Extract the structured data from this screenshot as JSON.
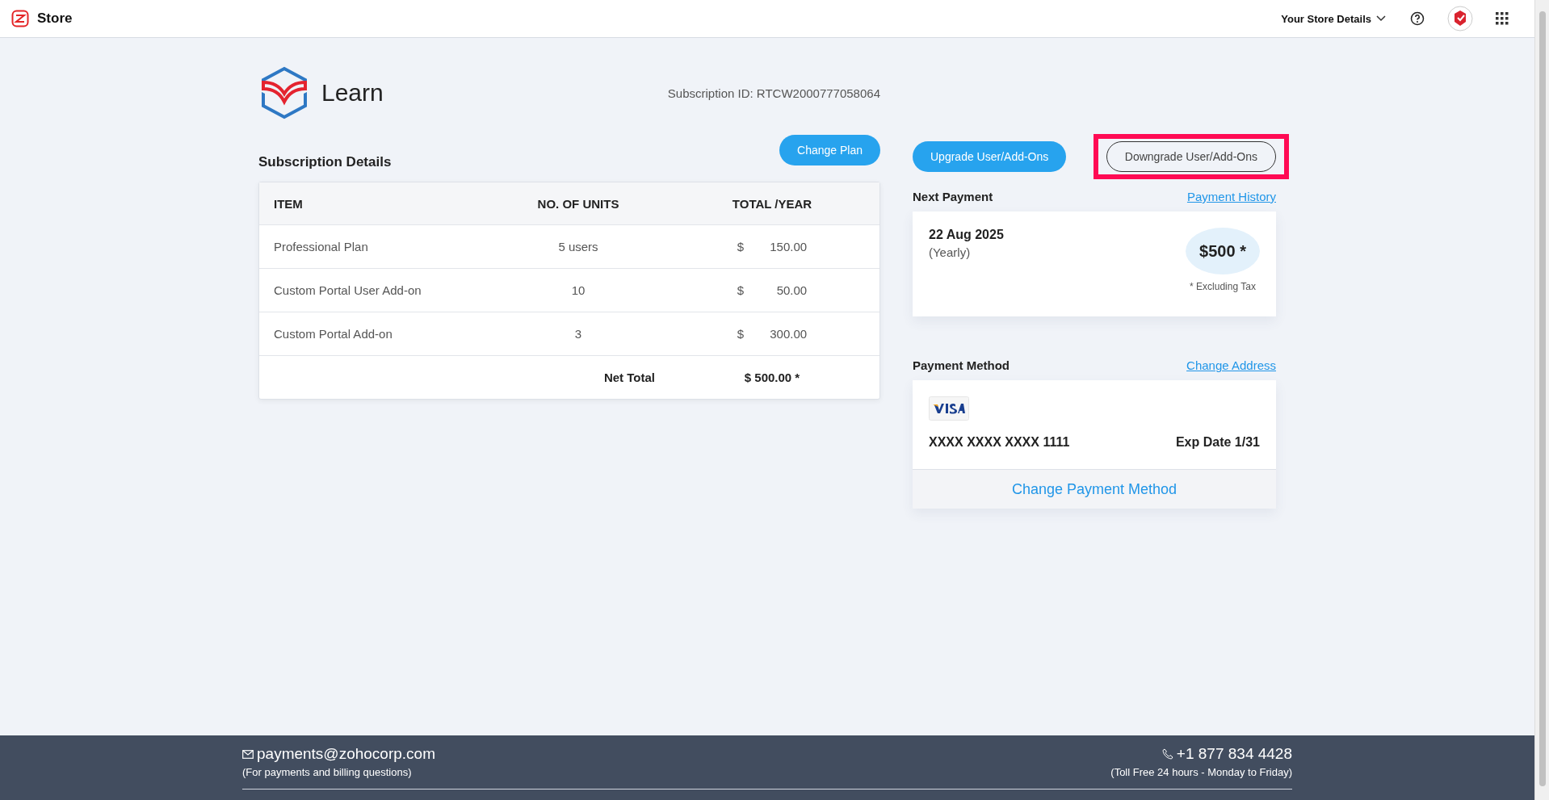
{
  "topbar": {
    "app_name": "Store",
    "store_menu": "Your Store Details"
  },
  "product": {
    "name": "Learn",
    "subscription_id": "Subscription ID: RTCW2000777058064"
  },
  "subscription": {
    "title": "Subscription Details",
    "change_plan": "Change Plan",
    "columns": [
      "ITEM",
      "NO. OF UNITS",
      "TOTAL /YEAR"
    ],
    "rows": [
      {
        "item": "Professional Plan",
        "units": "5 users",
        "currency": "$",
        "amount": "150.00"
      },
      {
        "item": "Custom Portal User Add-on",
        "units": "10",
        "currency": "$",
        "amount": "50.00"
      },
      {
        "item": "Custom Portal Add-on",
        "units": "3",
        "currency": "$",
        "amount": "300.00"
      }
    ],
    "net_total_label": "Net Total",
    "net_total": "$ 500.00 *"
  },
  "actions": [
    {
      "label": "Upgrade User/Add-Ons",
      "kind": "primary",
      "highlighted": false
    },
    {
      "label": "Downgrade User/Add-Ons",
      "kind": "outline",
      "highlighted": true
    }
  ],
  "next_payment": {
    "title": "Next Payment",
    "link": "Payment History",
    "date": "22 Aug 2025",
    "cycle": "(Yearly)",
    "amount": "$500 *",
    "note": "* Excluding Tax"
  },
  "payment_method": {
    "title": "Payment Method",
    "link": "Change Address",
    "card_number": "XXXX XXXX XXXX 1111",
    "expiry": "Exp Date 1/31",
    "change": "Change Payment Method"
  },
  "footer": {
    "email": "payments@zohocorp.com",
    "email_note": "(For payments and billing questions)",
    "phone": "+1 877 834 4428",
    "phone_note": "(Toll Free 24 hours - Monday to Friday)"
  }
}
